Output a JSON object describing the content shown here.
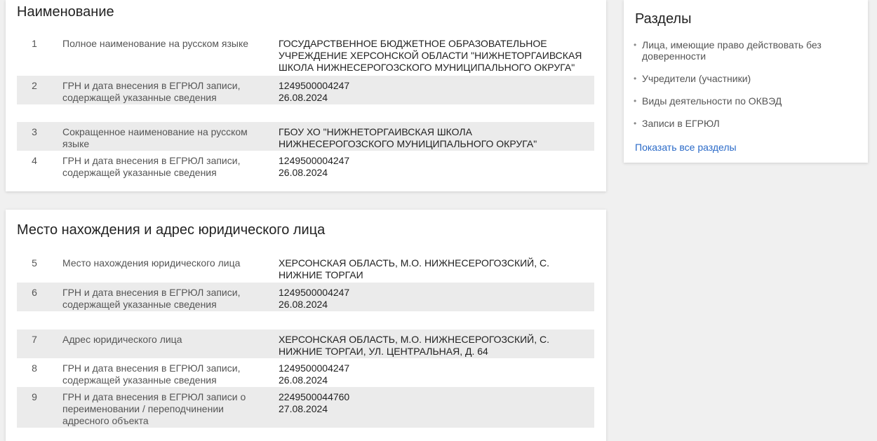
{
  "name_section": {
    "title": "Наименование",
    "rows": [
      {
        "num": "1",
        "label": "Полное наименование на русском языке",
        "value": [
          "ГОСУДАРСТВЕННОЕ БЮДЖЕТНОЕ ОБРАЗОВАТЕЛЬНОЕ",
          "УЧРЕЖДЕНИЕ ХЕРСОНСКОЙ ОБЛАСТИ \"НИЖНЕТОРГАИВСКАЯ",
          "ШКОЛА НИЖНЕСЕРОГОЗСКОГО МУНИЦИПАЛЬНОГО ОКРУГА\""
        ]
      },
      {
        "num": "2",
        "label": "ГРН и дата внесения в ЕГРЮЛ записи, содержащей указанные сведения",
        "value": [
          "1249500004247",
          "26.08.2024"
        ]
      },
      {
        "num": "3",
        "label": "Сокращенное наименование на русском языке",
        "value": [
          "ГБОУ ХО \"НИЖНЕТОРГАИВСКАЯ ШКОЛА",
          "НИЖНЕСЕРОГОЗСКОГО МУНИЦИПАЛЬНОГО ОКРУГА\""
        ]
      },
      {
        "num": "4",
        "label": "ГРН и дата внесения в ЕГРЮЛ записи, содержащей указанные сведения",
        "value": [
          "1249500004247",
          "26.08.2024"
        ]
      }
    ]
  },
  "address_section": {
    "title": "Место нахождения и адрес юридического лица",
    "rows": [
      {
        "num": "5",
        "label": "Место нахождения юридического лица",
        "value": [
          "ХЕРСОНСКАЯ ОБЛАСТЬ, М.О. НИЖНЕСЕРОГОЗСКИЙ, С.",
          "НИЖНИЕ ТОРГАИ"
        ]
      },
      {
        "num": "6",
        "label": "ГРН и дата внесения в ЕГРЮЛ записи, содержащей указанные сведения",
        "value": [
          "1249500004247",
          "26.08.2024"
        ]
      },
      {
        "num": "7",
        "label": "Адрес юридического лица",
        "value": [
          "ХЕРСОНСКАЯ ОБЛАСТЬ, М.О. НИЖНЕСЕРОГОЗСКИЙ, С.",
          "НИЖНИЕ ТОРГАИ, УЛ. ЦЕНТРАЛЬНАЯ, Д. 64"
        ]
      },
      {
        "num": "8",
        "label": "ГРН и дата внесения в ЕГРЮЛ записи, содержащей указанные сведения",
        "value": [
          "1249500004247",
          "26.08.2024"
        ]
      },
      {
        "num": "9",
        "label": "ГРН и дата внесения в ЕГРЮЛ записи о переименовании / переподчинении адресного объекта",
        "value": [
          "2249500044760",
          "27.08.2024"
        ]
      }
    ]
  },
  "sections_panel": {
    "title": "Разделы",
    "items": [
      "Лица, имеющие право действовать без доверенности",
      "Учредители (участники)",
      "Виды деятельности по ОКВЭД",
      "Записи в ЕГРЮЛ"
    ],
    "show_all": "Показать все разделы"
  },
  "colors": {
    "link": "#2a6ac8",
    "row_shade": "#ebebeb",
    "page_bg": "#f0f0f0"
  }
}
